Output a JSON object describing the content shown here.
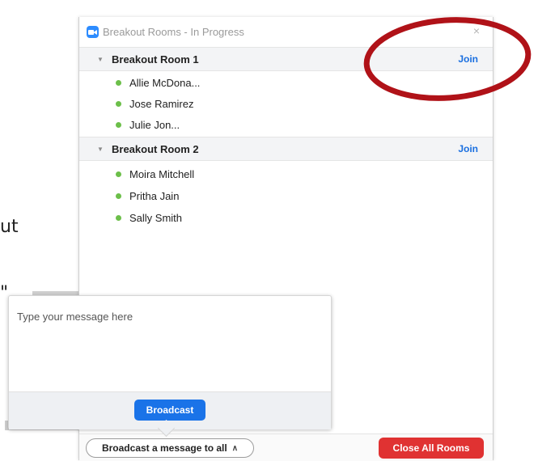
{
  "window": {
    "title": "Breakout Rooms - In Progress",
    "close_symbol": "×"
  },
  "background": {
    "fragment_1": "ut",
    "fragment_2": "\""
  },
  "rooms": [
    {
      "name": "Breakout Room 1",
      "join_label": "Join",
      "participants": [
        "Allie McDona...",
        "Jose Ramirez",
        "Julie Jon..."
      ]
    },
    {
      "name": "Breakout Room 2",
      "join_label": "Join",
      "participants": [
        "Moira Mitchell",
        "Pritha Jain",
        "Sally Smith"
      ]
    }
  ],
  "broadcast_popup": {
    "placeholder": "Type your message here",
    "button_label": "Broadcast"
  },
  "bottom_bar": {
    "broadcast_toggle_label": "Broadcast a message to all",
    "close_all_label": "Close All Rooms"
  },
  "colors": {
    "accent": "#1a73e8",
    "danger": "#e03232",
    "participant_dot": "#6cbf4a",
    "annotation": "#b01218"
  }
}
